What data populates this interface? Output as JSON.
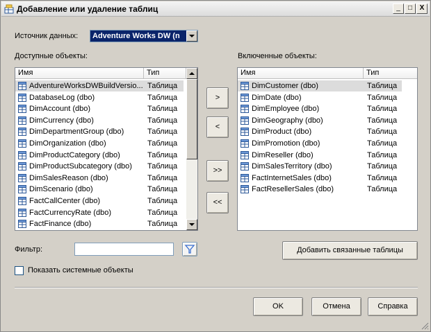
{
  "window": {
    "title": "Добавление или удаление таблиц",
    "controls": {
      "minimize": "_",
      "maximize": "□",
      "close": "X"
    }
  },
  "source": {
    "label": "Источник данных:",
    "selected": "Adventure Works DW (n"
  },
  "available": {
    "label": "Доступные объекты:",
    "columns": {
      "name": "Имя",
      "type": "Тип"
    },
    "rows": [
      {
        "name": "AdventureWorksDWBuildVersio...",
        "type": "Таблица",
        "selected": true
      },
      {
        "name": "DatabaseLog (dbo)",
        "type": "Таблица"
      },
      {
        "name": "DimAccount (dbo)",
        "type": "Таблица"
      },
      {
        "name": "DimCurrency (dbo)",
        "type": "Таблица"
      },
      {
        "name": "DimDepartmentGroup (dbo)",
        "type": "Таблица"
      },
      {
        "name": "DimOrganization (dbo)",
        "type": "Таблица"
      },
      {
        "name": "DimProductCategory (dbo)",
        "type": "Таблица"
      },
      {
        "name": "DimProductSubcategory (dbo)",
        "type": "Таблица"
      },
      {
        "name": "DimSalesReason (dbo)",
        "type": "Таблица"
      },
      {
        "name": "DimScenario (dbo)",
        "type": "Таблица"
      },
      {
        "name": "FactCallCenter (dbo)",
        "type": "Таблица"
      },
      {
        "name": "FactCurrencyRate (dbo)",
        "type": "Таблица"
      },
      {
        "name": "FactFinance (dbo)",
        "type": "Таблица"
      }
    ]
  },
  "included": {
    "label": "Включенные объекты:",
    "columns": {
      "name": "Имя",
      "type": "Тип"
    },
    "rows": [
      {
        "name": "DimCustomer (dbo)",
        "type": "Таблица",
        "selected": true
      },
      {
        "name": "DimDate (dbo)",
        "type": "Таблица"
      },
      {
        "name": "DimEmployee (dbo)",
        "type": "Таблица"
      },
      {
        "name": "DimGeography (dbo)",
        "type": "Таблица"
      },
      {
        "name": "DimProduct (dbo)",
        "type": "Таблица"
      },
      {
        "name": "DimPromotion (dbo)",
        "type": "Таблица"
      },
      {
        "name": "DimReseller (dbo)",
        "type": "Таблица"
      },
      {
        "name": "DimSalesTerritory (dbo)",
        "type": "Таблица"
      },
      {
        "name": "FactInternetSales (dbo)",
        "type": "Таблица"
      },
      {
        "name": "FactResellerSales (dbo)",
        "type": "Таблица"
      }
    ]
  },
  "transfer": {
    "add": ">",
    "remove": "<",
    "add_all": ">>",
    "remove_all": "<<"
  },
  "filter": {
    "label": "Фильтр:",
    "value": ""
  },
  "add_related_label": "Добавить связанные таблицы",
  "show_system_label": "Показать системные объекты",
  "show_system_checked": false,
  "dialog": {
    "ok": "OK",
    "cancel": "Отмена",
    "help": "Справка"
  },
  "colors": {
    "dialog_bg": "#d4d0c8",
    "selection": "#0a246a",
    "filter_icon": "#3a6fd0"
  },
  "icons": {
    "app": "app-table-icon",
    "table": "table-icon",
    "filter": "filter-icon"
  }
}
